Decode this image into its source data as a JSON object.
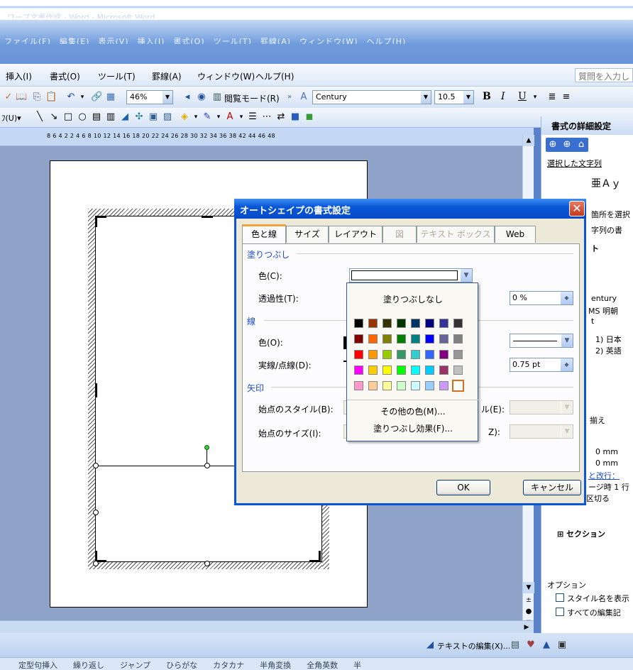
{
  "window": {
    "faded_title": "ワープ文書作成 - Word - Microsoft Word"
  },
  "old_menu": {
    "ghost_text": "ファイル(F)　編集(E)　表示(V)　挿入(I)　書式(O)　ツール(T)　罫線(A)　ウィンドウ(W)　ヘルプ(H)"
  },
  "menu": {
    "items": [
      "挿入(I)",
      "書式(O)",
      "ツール(T)",
      "罫線(A)",
      "ウィンドウ(W)",
      "ヘルプ(H)"
    ],
    "help_placeholder": "質問を入力し"
  },
  "toolbar": {
    "zoom": "46%",
    "reading_mode": "閲覧モード(R)",
    "font_name": "Century",
    "font_size": "10.5",
    "bold": "B",
    "italic": "I",
    "underline": "U"
  },
  "ruler": {
    "numbers": "8 6 4 2   2 4 6 8 10 12 14 16 18 20 22 24 26 28 30 32 34 36 38   42 44 46 48"
  },
  "task_pane": {
    "title": "書式の詳細設定",
    "selected_text_label": "選択した文字列",
    "sample": "亜Ａｙ",
    "lines": [
      "箇所を選択",
      "字列の書",
      "ト",
      "entury",
      "MS 明朝",
      "t",
      "1) 日本",
      "2) 英語",
      "揃え",
      "0 mm",
      "0 mm",
      "と改行：",
      "ージ時 1 行",
      "を区切る"
    ],
    "section_label": "⊞ セクション",
    "options_label": "オプション",
    "checkbox1": "スタイル名を表示",
    "checkbox2": "すべての編集記"
  },
  "dialog": {
    "title": "オートシェイプの書式設定",
    "tabs": [
      "色と線",
      "サイズ",
      "レイアウト",
      "図",
      "テキスト ボックス",
      "Web"
    ],
    "fill_section": "塗りつぶし",
    "fill_color_label": "色(C):",
    "transparency_label": "透過性(T):",
    "transparency_value": "0 %",
    "line_section": "線",
    "line_color_label": "色(O):",
    "dash_label": "実線/点線(D):",
    "weight_value": "0.75 pt",
    "arrow_section": "矢印",
    "begin_style_label": "始点のスタイル(B):",
    "end_style_label": "ル(E):",
    "begin_size_label": "始点のサイズ(I):",
    "end_size_label": "Z):",
    "ok": "OK",
    "cancel": "キャンセル"
  },
  "palette": {
    "no_fill": "塗りつぶしなし",
    "more_colors": "その他の色(M)...",
    "fill_effects": "塗りつぶし効果(F)...",
    "colors": [
      [
        "#000000",
        "#993300",
        "#333300",
        "#003300",
        "#003366",
        "#000080",
        "#333399",
        "#333333"
      ],
      [
        "#800000",
        "#ff6600",
        "#808000",
        "#008000",
        "#008080",
        "#0000ff",
        "#666699",
        "#808080"
      ],
      [
        "#ff0000",
        "#ff9900",
        "#99cc00",
        "#339966",
        "#33cccc",
        "#3366ff",
        "#800080",
        "#969696"
      ],
      [
        "#ff00ff",
        "#ffcc00",
        "#ffff00",
        "#00ff00",
        "#00ffff",
        "#00ccff",
        "#993366",
        "#c0c0c0"
      ],
      [
        "#ff99cc",
        "#ffcc99",
        "#ffff99",
        "#ccffcc",
        "#ccffff",
        "#99ccff",
        "#cc99ff",
        "#ffffff"
      ]
    ]
  },
  "status_bar": {
    "text_edit": "テキストの編集(X)...",
    "items": "定型句挿入　　繰り返し　　ジャンプ　　ひらがな　　カタカナ　　半角変換　　全角英数　　半"
  }
}
